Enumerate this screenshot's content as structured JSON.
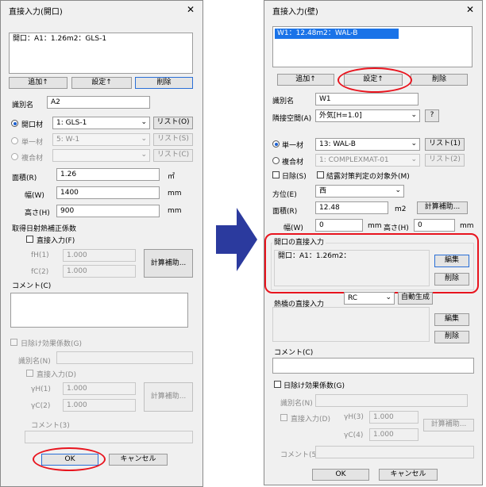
{
  "left": {
    "title": "直接入力(開口)",
    "close": "✕",
    "list_item": "開口：A1：1.26m2：GLS-1",
    "add_btn": "追加↑",
    "set_btn": "設定↑",
    "del_btn": "削除",
    "id_label": "識別名",
    "id_value": "A2",
    "radio1": "開口材",
    "sel1": "1: GLS-1",
    "list_btn1": "リスト(O)",
    "radio2": "単一材",
    "sel2": "5: W-1",
    "list_btn2": "リスト(S)",
    "radio3": "複合材",
    "list_btn3": "リスト(C)",
    "area_label": "面積(R)",
    "area_value": "1.26",
    "area_unit": "㎡",
    "width_label": "幅(W)",
    "width_value": "1400",
    "width_unit": "mm",
    "height_label": "高さ(H)",
    "height_value": "900",
    "height_unit": "mm",
    "solar_label": "取得日射熱補正係数",
    "direct_chk": "直接入力(F)",
    "fh_label": "fH(1)",
    "fh_value": "1.000",
    "fc_label": "fC(2)",
    "fc_value": "1.000",
    "calc_btn": "計算補助...",
    "comment_label": "コメント(C)",
    "shade_chk": "日除け効果係数(G)",
    "shade_id_label": "識別名(N)",
    "shade_direct": "直接入力(D)",
    "gh_label": "γH(1)",
    "gh_value": "1.000",
    "gc_label": "γC(2)",
    "gc_value": "1.000",
    "calc_btn2": "計算補助...",
    "comment3_label": "コメント(3)",
    "ok_btn": "OK",
    "cancel_btn": "キャンセル"
  },
  "right": {
    "title": "直接入力(壁)",
    "close": "✕",
    "list_item": "W1：12.48m2：WAL-B",
    "add_btn": "追加↑",
    "set_btn": "設定↑",
    "del_btn": "削除",
    "id_label": "識別名",
    "id_value": "W1",
    "adj_label": "隣接空間(A)",
    "adj_value": "外気[H=1.0]",
    "help_btn": "?",
    "radio1": "単一材",
    "sel1": "13: WAL-B",
    "list_btn1": "リスト(1)",
    "radio2": "複合材",
    "sel2": "1: COMPLEXMAT-01",
    "list_btn2": "リスト(2)",
    "shade_chk": "日除(S)",
    "cond_chk": "結露対策判定の対象外(M)",
    "dir_label": "方位(E)",
    "dir_value": "西",
    "area_label": "面積(R)",
    "area_value": "12.48",
    "area_unit": "m2",
    "calc_btn": "計算補助...",
    "width_label": "幅(W)",
    "width_value": "0",
    "width_unit": "mm",
    "height_label": "高さ(H)",
    "height_value": "0",
    "height_unit": "mm",
    "opening_label": "開口の直接入力",
    "opening_item": "開口：A1：1.26m2：",
    "edit_btn": "編集",
    "del_btn2": "削除",
    "thermal_label": "熱橋の直接入力",
    "thermal_value": "RC",
    "auto_btn": "自動生成",
    "edit_btn2": "編集",
    "del_btn3": "削除",
    "comment_label": "コメント(C)",
    "shade_coef_chk": "日除け効果係数(G)",
    "shade_id_label": "識別名(N)",
    "shade_direct": "直接入力(D)",
    "gh_label": "γH(3)",
    "gh_value": "1.000",
    "gc_label": "γC(4)",
    "gc_value": "1.000",
    "calc_btn2": "計算補助...",
    "comment5_label": "コメント(5)",
    "ok_btn": "OK",
    "cancel_btn": "キャンセル"
  },
  "colors": {
    "highlight": "#e8141e",
    "arrow": "#2b3a9e",
    "selection": "#1a73e8"
  }
}
